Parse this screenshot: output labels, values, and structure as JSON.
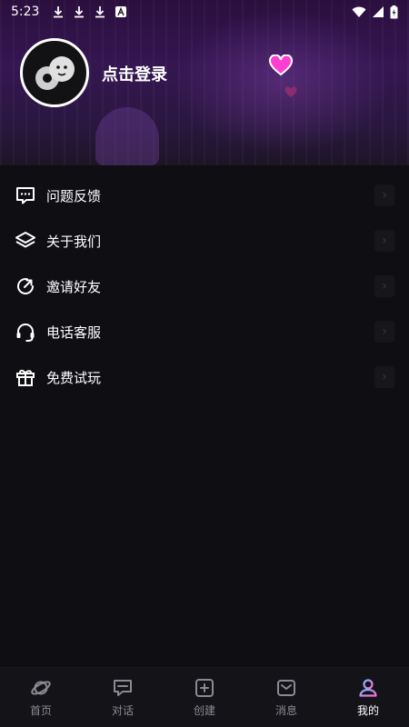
{
  "status_bar": {
    "time": "5:23"
  },
  "profile": {
    "login_prompt": "点击登录"
  },
  "menu": {
    "items": [
      {
        "label": "问题反馈",
        "icon": "message-square-icon"
      },
      {
        "label": "关于我们",
        "icon": "layers-icon"
      },
      {
        "label": "邀请好友",
        "icon": "share-icon"
      },
      {
        "label": "电话客服",
        "icon": "headset-icon"
      },
      {
        "label": "免费试玩",
        "icon": "gift-icon"
      }
    ]
  },
  "tabbar": {
    "active": "我的",
    "tabs": [
      {
        "label": "首页",
        "icon": "planet-icon"
      },
      {
        "label": "对话",
        "icon": "chat-icon"
      },
      {
        "label": "创建",
        "icon": "plus-square-icon"
      },
      {
        "label": "消息",
        "icon": "mail-icon"
      },
      {
        "label": "我的",
        "icon": "user-icon"
      }
    ]
  },
  "colors": {
    "accent_pink": "#ff3fd1",
    "background": "#0f0e13",
    "tab_inactive": "#8a8a92"
  }
}
